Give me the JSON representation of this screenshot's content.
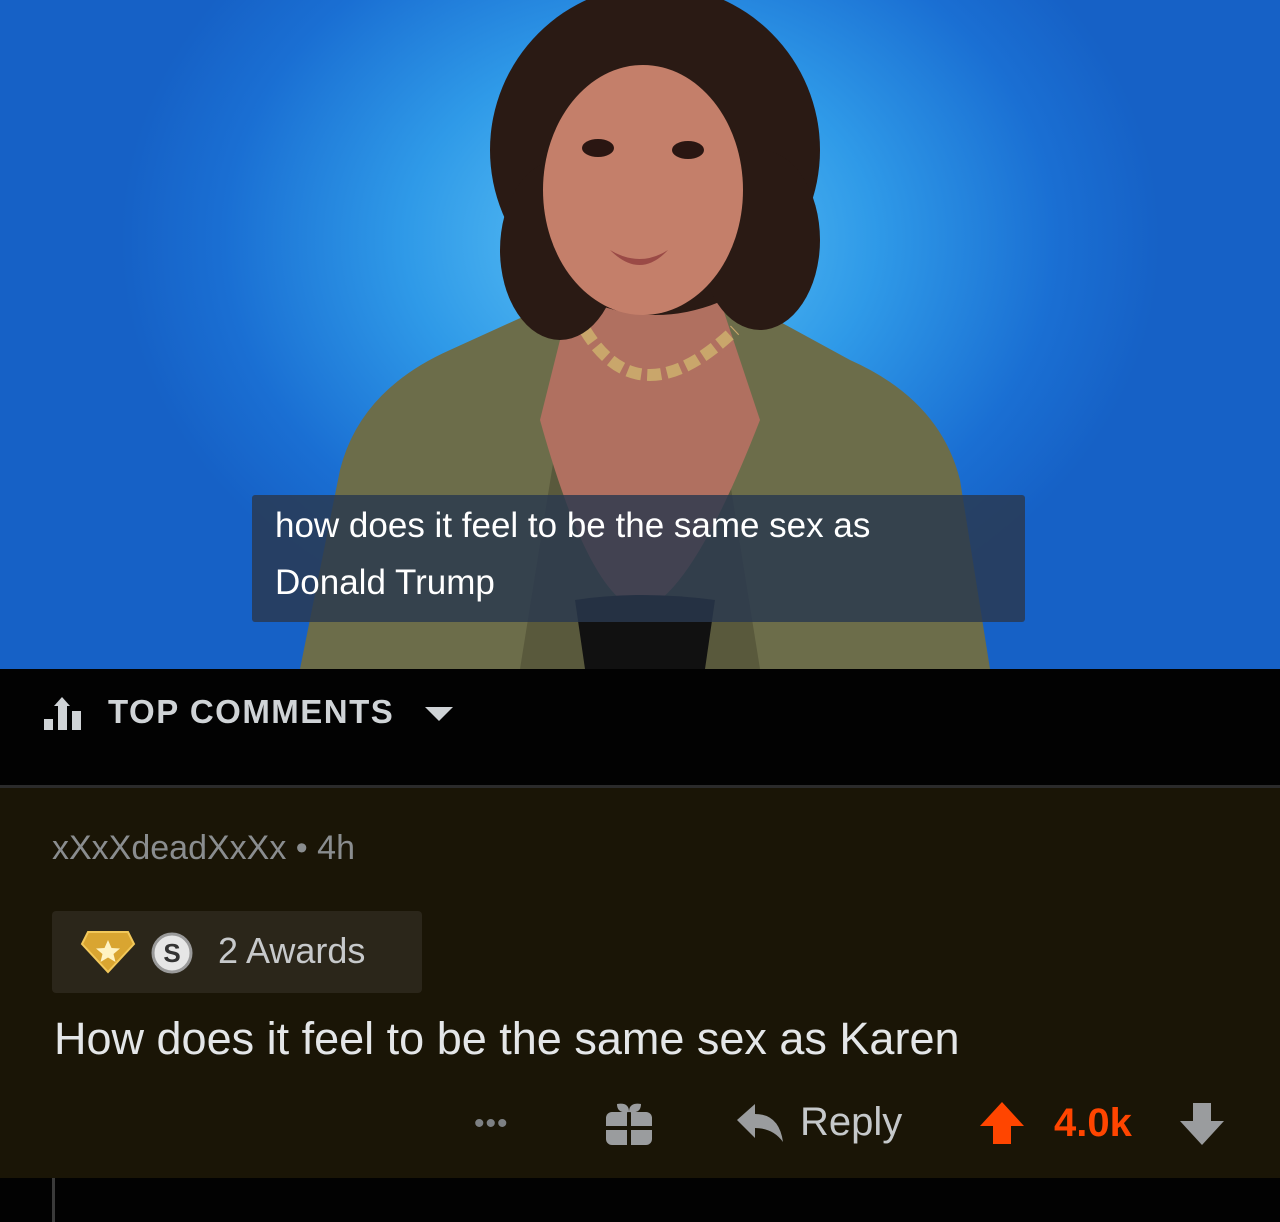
{
  "video": {
    "caption_line1": "how does it feel to be the same sex as",
    "caption_line2": "Donald Trump"
  },
  "sort": {
    "label": "TOP COMMENTS",
    "icon": "sort-bars-icon"
  },
  "comment": {
    "author": "xXxXdeadXxXx",
    "separator": " • ",
    "age": "4h",
    "awards_label": "2 Awards",
    "award_icons": [
      "gold-award-icon",
      "silver-award-icon"
    ],
    "body": "How does it feel to be the same sex as Karen",
    "actions": {
      "more_label": "•••",
      "reply_label": "Reply",
      "score": "4.0k"
    }
  },
  "colors": {
    "upvote_active": "#ff4500",
    "comment_bg": "#1a1506",
    "background": "#020202"
  }
}
